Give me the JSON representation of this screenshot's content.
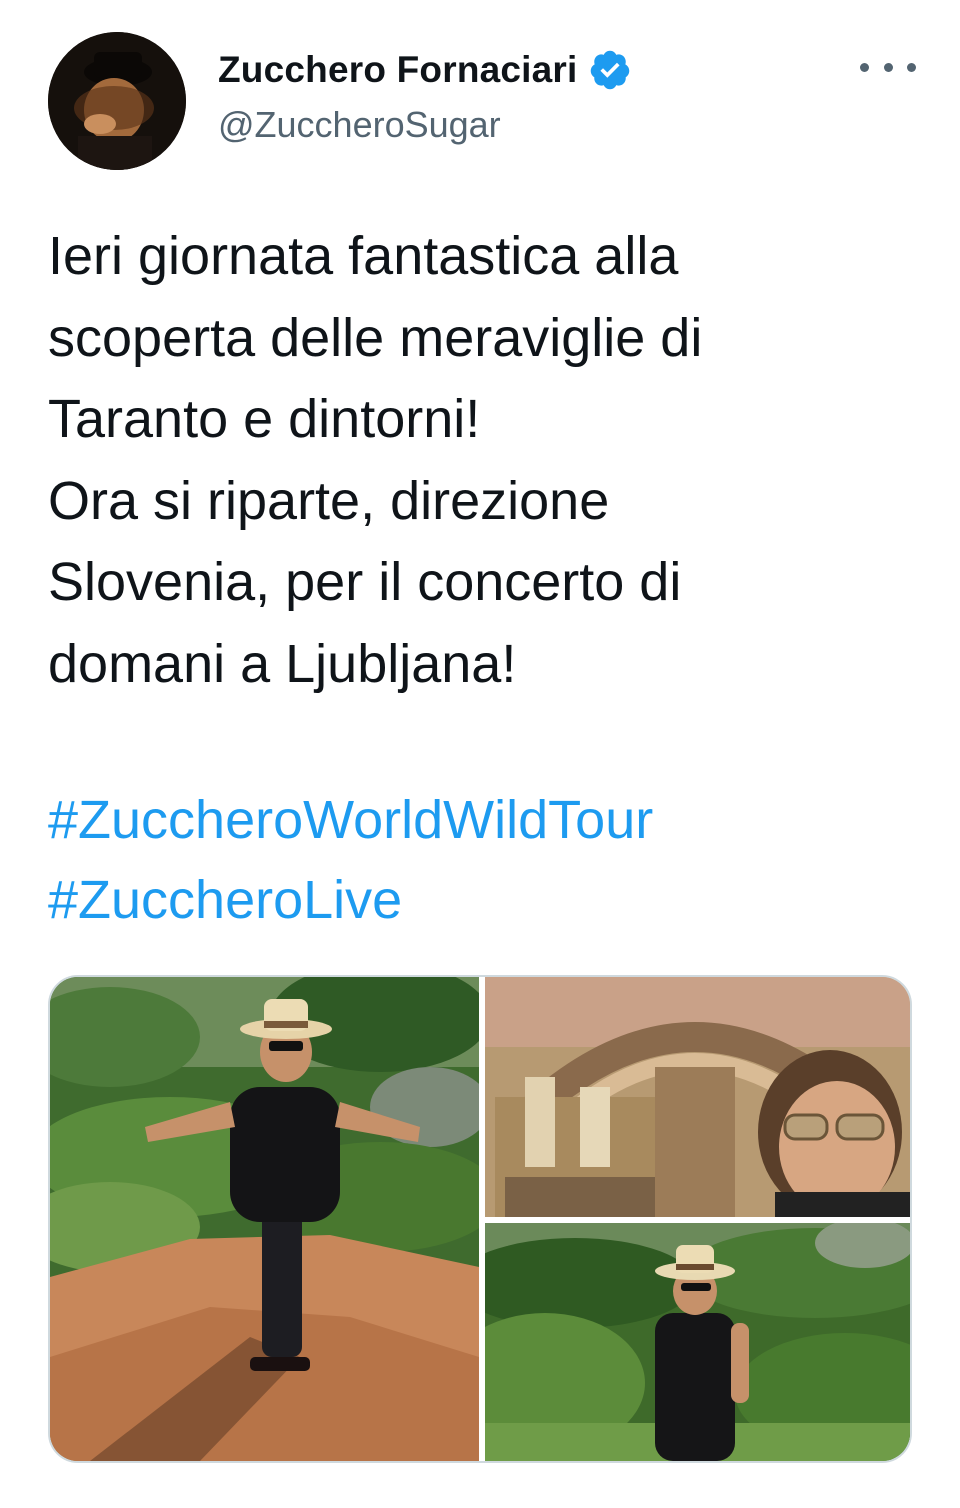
{
  "author": {
    "display_name": "Zucchero Fornaciari",
    "handle": "@ZuccheroSugar",
    "verified": true
  },
  "tweet": {
    "text_lines": [
      "Ieri giornata fantastica alla",
      "scoperta delle meraviglie di",
      "Taranto e dintorni!",
      "Ora si riparte, direzione",
      "Slovenia, per il concerto di",
      "domani a Ljubljana!"
    ],
    "hashtags": [
      "#ZuccheroWorldWildTour",
      "#ZuccheroLive"
    ]
  },
  "icons": {
    "verified": "verified-badge-icon",
    "more": "more-options-icon"
  },
  "colors": {
    "link": "#1d9bf0",
    "verified": "#1d9bf0",
    "text": "#0f1419",
    "secondary": "#536471",
    "border": "#cfd9de"
  },
  "media": {
    "count": 3
  }
}
